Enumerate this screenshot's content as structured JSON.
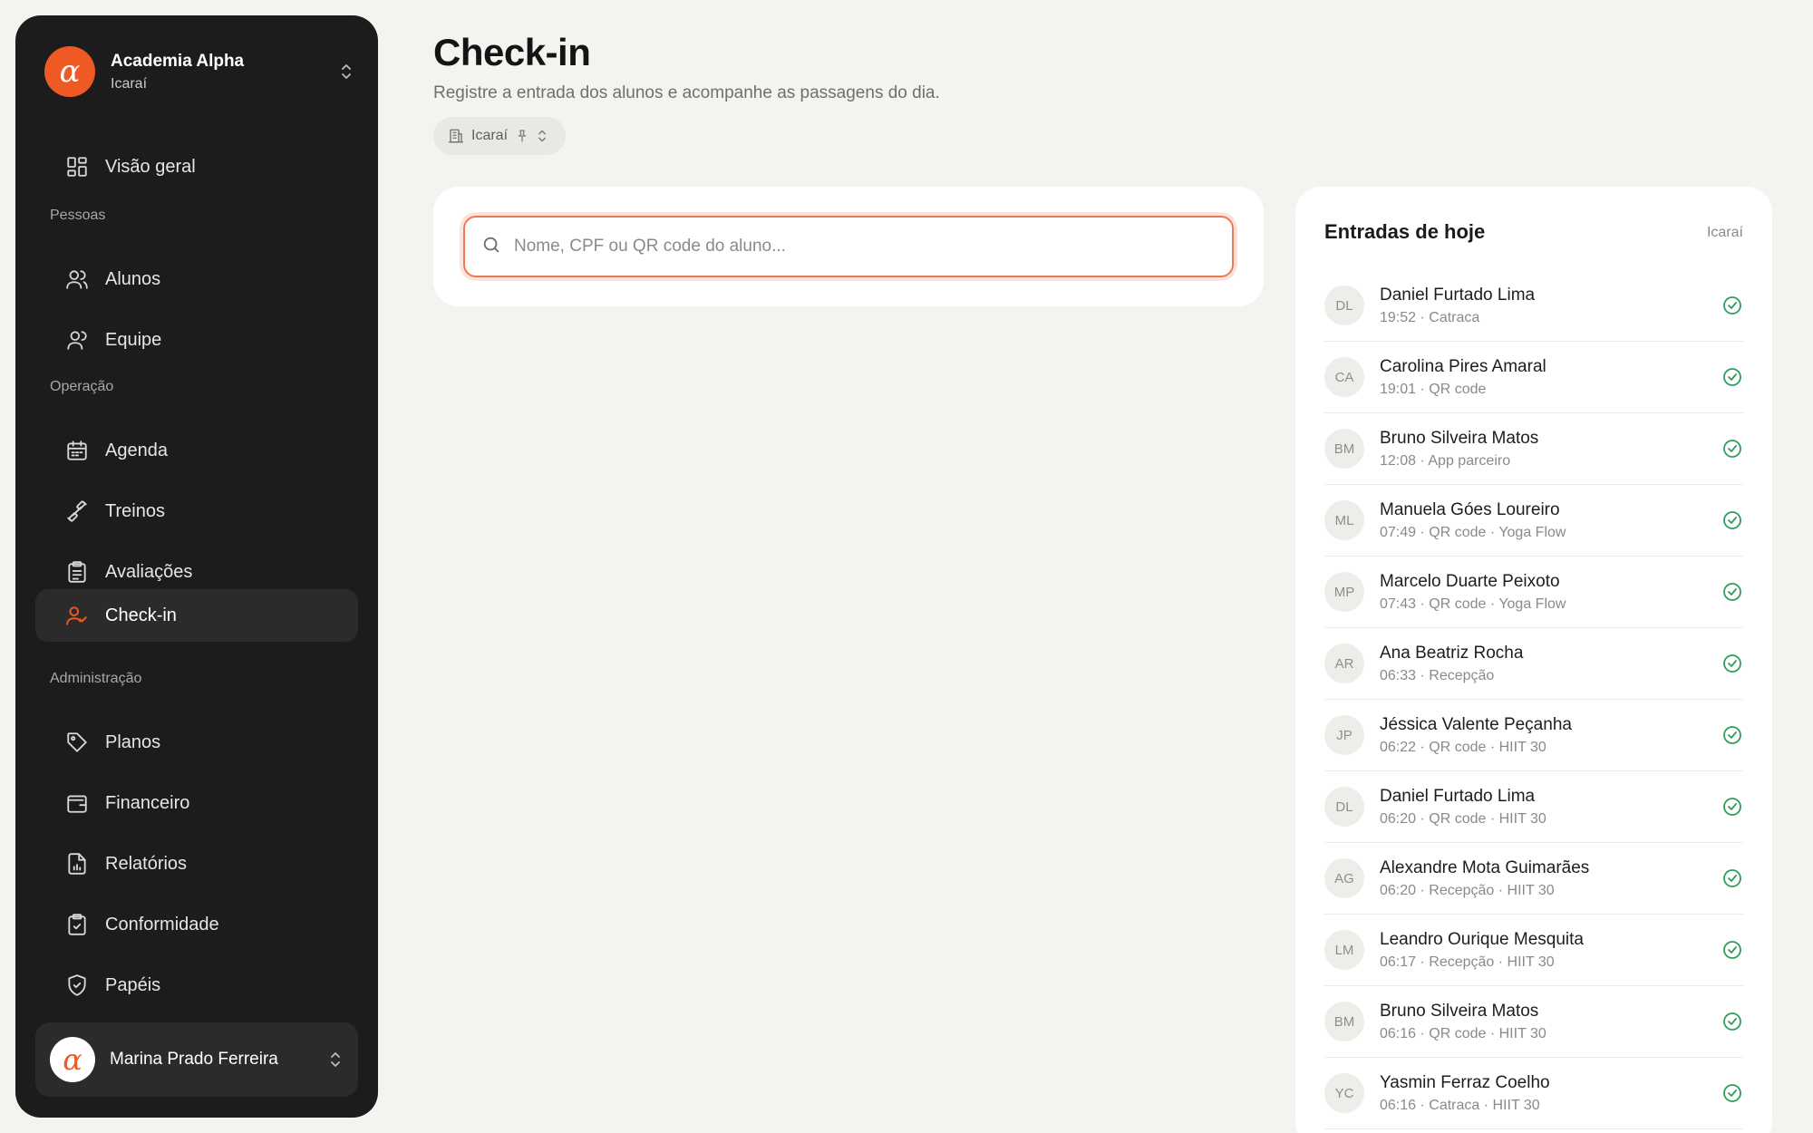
{
  "org": {
    "logo": "α",
    "name": "Academia Alpha",
    "unit": "Icaraí"
  },
  "nav": {
    "overview": "Visão geral",
    "section_people": "Pessoas",
    "students": "Alunos",
    "team": "Equipe",
    "section_operation": "Operação",
    "schedule": "Agenda",
    "workouts": "Treinos",
    "assessments": "Avaliações",
    "checkin": "Check-in",
    "section_admin": "Administração",
    "plans": "Planos",
    "finance": "Financeiro",
    "reports": "Relatórios",
    "compliance": "Conformidade",
    "roles": "Papéis"
  },
  "user": {
    "avatar": "α",
    "name": "Marina Prado Ferreira"
  },
  "page": {
    "title": "Check-in",
    "subtitle": "Registre a entrada dos alunos e acompanhe as passagens do dia.",
    "unit_chip": "Icaraí"
  },
  "search": {
    "placeholder": "Nome, CPF ou QR code do aluno..."
  },
  "entries": {
    "title": "Entradas de hoje",
    "unit": "Icaraí",
    "items": [
      {
        "initials": "DL",
        "name": "Daniel Furtado Lima",
        "meta": "19:52 · Catraca"
      },
      {
        "initials": "CA",
        "name": "Carolina Pires Amaral",
        "meta": "19:01 · QR code"
      },
      {
        "initials": "BM",
        "name": "Bruno Silveira Matos",
        "meta": "12:08 · App parceiro"
      },
      {
        "initials": "ML",
        "name": "Manuela Góes Loureiro",
        "meta": "07:49 · QR code · Yoga Flow"
      },
      {
        "initials": "MP",
        "name": "Marcelo Duarte Peixoto",
        "meta": "07:43 · QR code · Yoga Flow"
      },
      {
        "initials": "AR",
        "name": "Ana Beatriz Rocha",
        "meta": "06:33 · Recepção"
      },
      {
        "initials": "JP",
        "name": "Jéssica Valente Peçanha",
        "meta": "06:22 · QR code · HIIT 30"
      },
      {
        "initials": "DL",
        "name": "Daniel Furtado Lima",
        "meta": "06:20 · QR code · HIIT 30"
      },
      {
        "initials": "AG",
        "name": "Alexandre Mota Guimarães",
        "meta": "06:20 · Recepção · HIIT 30"
      },
      {
        "initials": "LM",
        "name": "Leandro Ourique Mesquita",
        "meta": "06:17 · Recepção · HIIT 30"
      },
      {
        "initials": "BM",
        "name": "Bruno Silveira Matos",
        "meta": "06:16 · QR code · HIIT 30"
      },
      {
        "initials": "YC",
        "name": "Yasmin Ferraz Coelho",
        "meta": "06:16 · Catraca · HIIT 30"
      }
    ]
  },
  "colors": {
    "accent": "#ef5a24",
    "sidebar_bg": "#1c1c1c",
    "check": "#2e9e5b",
    "page_bg": "#f4f3f0"
  }
}
